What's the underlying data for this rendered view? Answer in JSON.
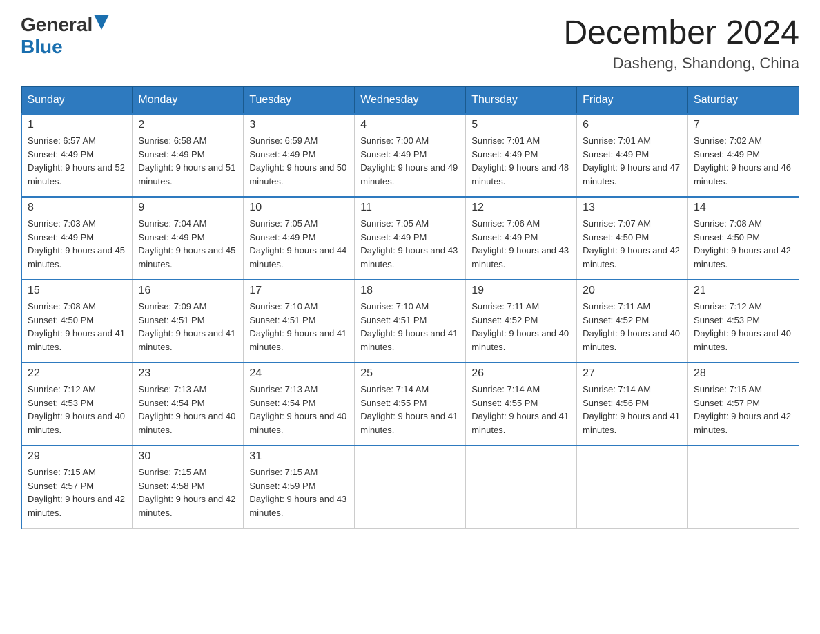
{
  "header": {
    "logo_general": "General",
    "logo_blue": "Blue",
    "month_year": "December 2024",
    "location": "Dasheng, Shandong, China"
  },
  "days_of_week": [
    "Sunday",
    "Monday",
    "Tuesday",
    "Wednesday",
    "Thursday",
    "Friday",
    "Saturday"
  ],
  "weeks": [
    [
      {
        "day": "1",
        "sunrise": "Sunrise: 6:57 AM",
        "sunset": "Sunset: 4:49 PM",
        "daylight": "Daylight: 9 hours and 52 minutes."
      },
      {
        "day": "2",
        "sunrise": "Sunrise: 6:58 AM",
        "sunset": "Sunset: 4:49 PM",
        "daylight": "Daylight: 9 hours and 51 minutes."
      },
      {
        "day": "3",
        "sunrise": "Sunrise: 6:59 AM",
        "sunset": "Sunset: 4:49 PM",
        "daylight": "Daylight: 9 hours and 50 minutes."
      },
      {
        "day": "4",
        "sunrise": "Sunrise: 7:00 AM",
        "sunset": "Sunset: 4:49 PM",
        "daylight": "Daylight: 9 hours and 49 minutes."
      },
      {
        "day": "5",
        "sunrise": "Sunrise: 7:01 AM",
        "sunset": "Sunset: 4:49 PM",
        "daylight": "Daylight: 9 hours and 48 minutes."
      },
      {
        "day": "6",
        "sunrise": "Sunrise: 7:01 AM",
        "sunset": "Sunset: 4:49 PM",
        "daylight": "Daylight: 9 hours and 47 minutes."
      },
      {
        "day": "7",
        "sunrise": "Sunrise: 7:02 AM",
        "sunset": "Sunset: 4:49 PM",
        "daylight": "Daylight: 9 hours and 46 minutes."
      }
    ],
    [
      {
        "day": "8",
        "sunrise": "Sunrise: 7:03 AM",
        "sunset": "Sunset: 4:49 PM",
        "daylight": "Daylight: 9 hours and 45 minutes."
      },
      {
        "day": "9",
        "sunrise": "Sunrise: 7:04 AM",
        "sunset": "Sunset: 4:49 PM",
        "daylight": "Daylight: 9 hours and 45 minutes."
      },
      {
        "day": "10",
        "sunrise": "Sunrise: 7:05 AM",
        "sunset": "Sunset: 4:49 PM",
        "daylight": "Daylight: 9 hours and 44 minutes."
      },
      {
        "day": "11",
        "sunrise": "Sunrise: 7:05 AM",
        "sunset": "Sunset: 4:49 PM",
        "daylight": "Daylight: 9 hours and 43 minutes."
      },
      {
        "day": "12",
        "sunrise": "Sunrise: 7:06 AM",
        "sunset": "Sunset: 4:49 PM",
        "daylight": "Daylight: 9 hours and 43 minutes."
      },
      {
        "day": "13",
        "sunrise": "Sunrise: 7:07 AM",
        "sunset": "Sunset: 4:50 PM",
        "daylight": "Daylight: 9 hours and 42 minutes."
      },
      {
        "day": "14",
        "sunrise": "Sunrise: 7:08 AM",
        "sunset": "Sunset: 4:50 PM",
        "daylight": "Daylight: 9 hours and 42 minutes."
      }
    ],
    [
      {
        "day": "15",
        "sunrise": "Sunrise: 7:08 AM",
        "sunset": "Sunset: 4:50 PM",
        "daylight": "Daylight: 9 hours and 41 minutes."
      },
      {
        "day": "16",
        "sunrise": "Sunrise: 7:09 AM",
        "sunset": "Sunset: 4:51 PM",
        "daylight": "Daylight: 9 hours and 41 minutes."
      },
      {
        "day": "17",
        "sunrise": "Sunrise: 7:10 AM",
        "sunset": "Sunset: 4:51 PM",
        "daylight": "Daylight: 9 hours and 41 minutes."
      },
      {
        "day": "18",
        "sunrise": "Sunrise: 7:10 AM",
        "sunset": "Sunset: 4:51 PM",
        "daylight": "Daylight: 9 hours and 41 minutes."
      },
      {
        "day": "19",
        "sunrise": "Sunrise: 7:11 AM",
        "sunset": "Sunset: 4:52 PM",
        "daylight": "Daylight: 9 hours and 40 minutes."
      },
      {
        "day": "20",
        "sunrise": "Sunrise: 7:11 AM",
        "sunset": "Sunset: 4:52 PM",
        "daylight": "Daylight: 9 hours and 40 minutes."
      },
      {
        "day": "21",
        "sunrise": "Sunrise: 7:12 AM",
        "sunset": "Sunset: 4:53 PM",
        "daylight": "Daylight: 9 hours and 40 minutes."
      }
    ],
    [
      {
        "day": "22",
        "sunrise": "Sunrise: 7:12 AM",
        "sunset": "Sunset: 4:53 PM",
        "daylight": "Daylight: 9 hours and 40 minutes."
      },
      {
        "day": "23",
        "sunrise": "Sunrise: 7:13 AM",
        "sunset": "Sunset: 4:54 PM",
        "daylight": "Daylight: 9 hours and 40 minutes."
      },
      {
        "day": "24",
        "sunrise": "Sunrise: 7:13 AM",
        "sunset": "Sunset: 4:54 PM",
        "daylight": "Daylight: 9 hours and 40 minutes."
      },
      {
        "day": "25",
        "sunrise": "Sunrise: 7:14 AM",
        "sunset": "Sunset: 4:55 PM",
        "daylight": "Daylight: 9 hours and 41 minutes."
      },
      {
        "day": "26",
        "sunrise": "Sunrise: 7:14 AM",
        "sunset": "Sunset: 4:55 PM",
        "daylight": "Daylight: 9 hours and 41 minutes."
      },
      {
        "day": "27",
        "sunrise": "Sunrise: 7:14 AM",
        "sunset": "Sunset: 4:56 PM",
        "daylight": "Daylight: 9 hours and 41 minutes."
      },
      {
        "day": "28",
        "sunrise": "Sunrise: 7:15 AM",
        "sunset": "Sunset: 4:57 PM",
        "daylight": "Daylight: 9 hours and 42 minutes."
      }
    ],
    [
      {
        "day": "29",
        "sunrise": "Sunrise: 7:15 AM",
        "sunset": "Sunset: 4:57 PM",
        "daylight": "Daylight: 9 hours and 42 minutes."
      },
      {
        "day": "30",
        "sunrise": "Sunrise: 7:15 AM",
        "sunset": "Sunset: 4:58 PM",
        "daylight": "Daylight: 9 hours and 42 minutes."
      },
      {
        "day": "31",
        "sunrise": "Sunrise: 7:15 AM",
        "sunset": "Sunset: 4:59 PM",
        "daylight": "Daylight: 9 hours and 43 minutes."
      },
      null,
      null,
      null,
      null
    ]
  ]
}
